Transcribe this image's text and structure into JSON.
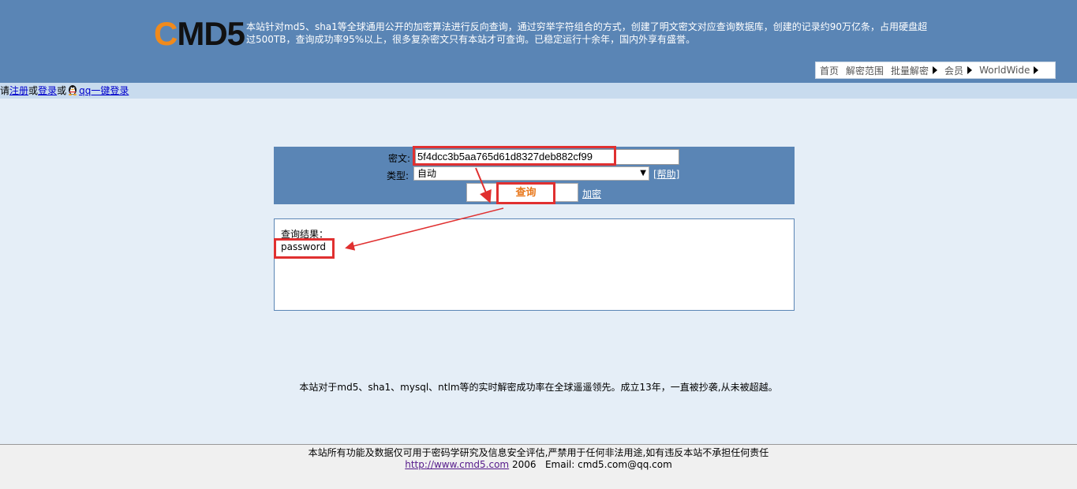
{
  "header": {
    "logo_c": "C",
    "logo_rest": "MD5",
    "intro": "本站针对md5、sha1等全球通用公开的加密算法进行反向查询，通过穷举字符组合的方式，创建了明文密文对应查询数据库，创建的记录约90万亿条，占用硬盘超过500TB，查询成功率95%以上，很多复杂密文只有本站才可查询。已稳定运行十余年，国内外享有盛誉。",
    "nav": [
      "首页",
      "解密范围",
      "批量解密",
      "会员",
      "WorldWide"
    ]
  },
  "login_bar": {
    "prefix": "请",
    "register": "注册",
    "or1": "或",
    "login": "登录",
    "or2": "或",
    "qq_login": "qq一键登录"
  },
  "form": {
    "cipher_label": "密文:",
    "cipher_value": "5f4dcc3b5aa765d61d8327deb882cf99",
    "type_label": "类型:",
    "type_value": "自动",
    "help": "[帮助]",
    "query_button": "查询",
    "encrypt_link": "加密"
  },
  "result": {
    "label": "查询结果：",
    "value": "password"
  },
  "claim": "本站对于md5、sha1、mysql、ntlm等的实时解密成功率在全球遥遥领先。成立13年，一直被抄袭,从未被超越。",
  "footer": {
    "disclaimer": "本站所有功能及数据仅可用于密码学研究及信息安全评估,严禁用于任何非法用途,如有违反本站不承担任何责任",
    "url": "http://www.cmd5.com",
    "year": "2006",
    "email": "Email: cmd5.com@qq.com"
  },
  "colors": {
    "header_bg": "#5a85b5",
    "logo_accent": "#f08a1c",
    "highlight": "#e03030",
    "query_text": "#e8781c"
  }
}
